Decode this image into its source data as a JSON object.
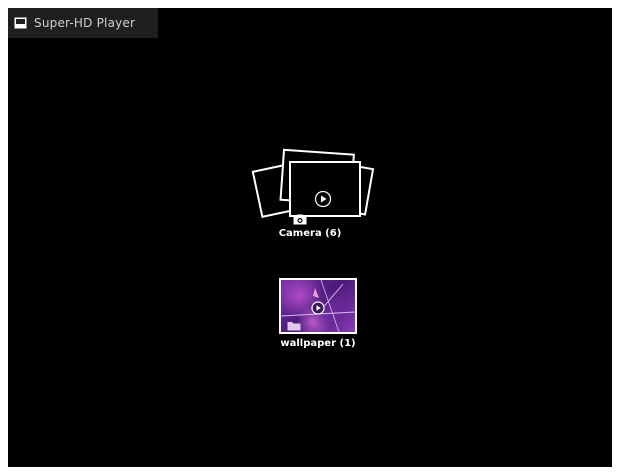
{
  "titlebar": {
    "title": "Super-HD Player",
    "icon": "image-icon"
  },
  "folders": [
    {
      "label": "Camera (6)",
      "icon": "camera-icon"
    },
    {
      "label": "wallpaper (1)",
      "icon": "folder-icon"
    }
  ],
  "colors": {
    "background": "#000000",
    "titlebar": "#1f1f1f",
    "text": "#ffffff",
    "thumbnail_purple": "#7a30a8"
  }
}
